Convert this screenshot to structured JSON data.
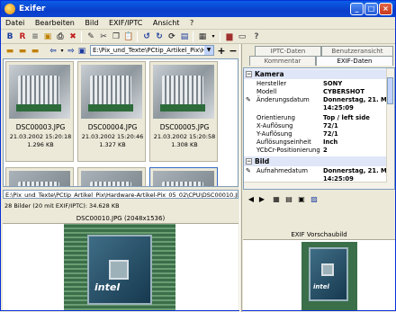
{
  "window": {
    "title": "Exifer",
    "min": "_",
    "max": "□",
    "close": "×"
  },
  "menu": [
    "Datei",
    "Bearbeiten",
    "Bild",
    "EXIF/IPTC",
    "Ansicht",
    "?"
  ],
  "path": {
    "value": "E:\\Pix_und_Texte\\PCtip_Artikel_Pix\\Hardw"
  },
  "thumbnails": [
    {
      "name": "DSC00003.JPG",
      "date": "21.03.2002 15:20:18",
      "size": "1.296 KB"
    },
    {
      "name": "DSC00004.JPG",
      "date": "21.03.2002 15:20:46",
      "size": "1.327 KB"
    },
    {
      "name": "DSC00005.JPG",
      "date": "21.03.2002 15:20:58",
      "size": "1.308 KB"
    }
  ],
  "status": {
    "fullpath": "E:\\Pix_und_Texte\\PCtip_Artikel_Pix\\Hardware-Artikel-Pix_05_02\\CPU\\DSC00010.JPG",
    "count": "28 Bilder (20 mit EXIF/IPTC): 34.628 KB"
  },
  "preview": {
    "title": "DSC00010.JPG (2048x1536)",
    "brand": "intel"
  },
  "tabs": {
    "iptc": "IPTC-Daten",
    "user": "Benutzeransicht",
    "comment": "Kommentar",
    "exif": "EXIF-Daten"
  },
  "exif": {
    "group_camera": "Kamera",
    "rows": [
      {
        "k": "Hersteller",
        "v": "SONY"
      },
      {
        "k": "Modell",
        "v": "CYBERSHOT"
      },
      {
        "k": "Änderungsdatum",
        "v": "Donnerstag, 21. Mä"
      },
      {
        "k": "",
        "v": "14:25:09"
      },
      {
        "k": "Orientierung",
        "v": "Top / left side"
      },
      {
        "k": "X-Auflösung",
        "v": "72/1"
      },
      {
        "k": "Y-Auflösung",
        "v": "72/1"
      },
      {
        "k": "Auflösungseinheit",
        "v": "Inch"
      },
      {
        "k": "YCbCr-Positionierung",
        "v": "2"
      }
    ],
    "group_image": "Bild",
    "rows2": [
      {
        "k": "Aufnahmedatum",
        "v": "Donnerstag, 21. Mä"
      },
      {
        "k": "",
        "v": "14:25:09"
      }
    ]
  },
  "exif_preview": {
    "title": "EXIF Vorschaubild"
  }
}
